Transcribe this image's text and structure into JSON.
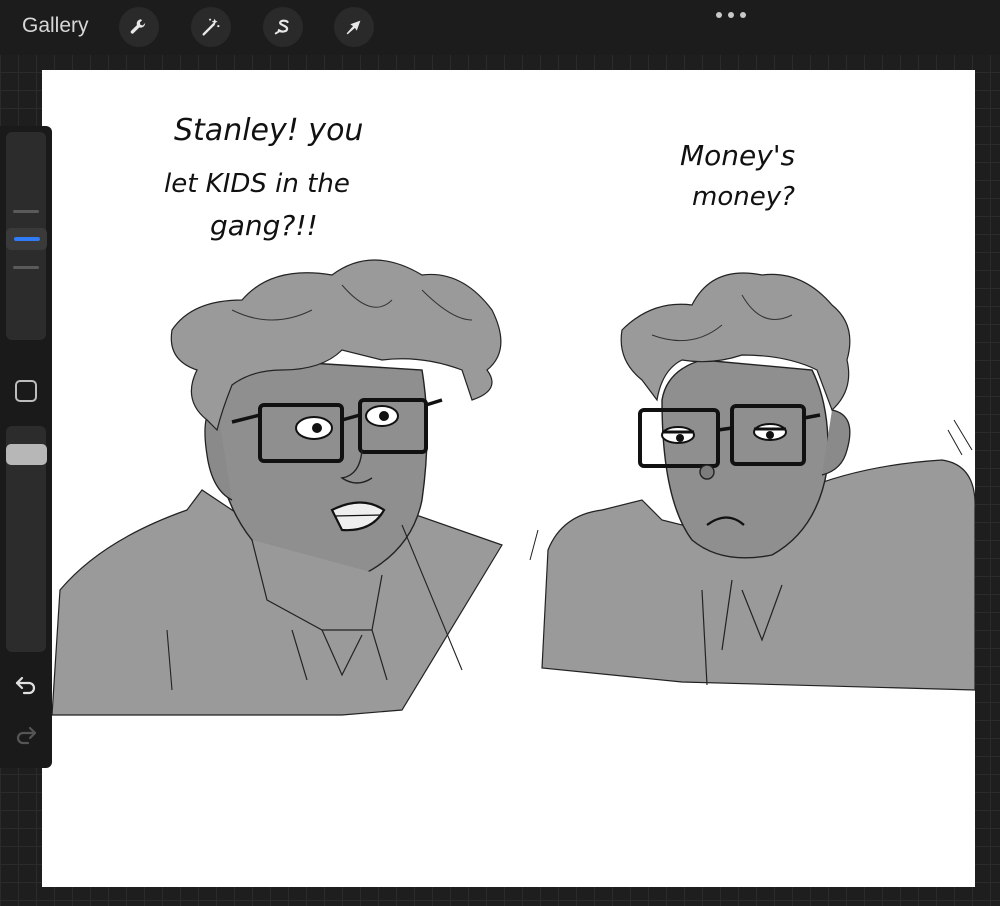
{
  "topbar": {
    "gallery_label": "Gallery",
    "tools": [
      "wrench-icon",
      "magic-wand-icon",
      "selection-s-icon",
      "transform-arrow-icon"
    ],
    "more_icon": "ellipsis-icon"
  },
  "sidebar": {
    "brush_size_level": 0.5,
    "modify_icon": "square-modify-icon",
    "opacity_level": 1.0,
    "undo_icon": "undo-arrow-icon",
    "redo_icon": "redo-arrow-icon"
  },
  "canvas": {
    "background": "#ffffff",
    "left_caption_line1": "Stanley! you",
    "left_caption_line2": "let KIDS in the",
    "left_caption_line3": "gang?!!",
    "right_caption_line1": "Money's",
    "right_caption_line2": "money?"
  },
  "colors": {
    "accent": "#2f7cf6",
    "ui_bg": "#1c1c1c",
    "sketch_fill": "#9a9a9a",
    "ink": "#111111"
  }
}
